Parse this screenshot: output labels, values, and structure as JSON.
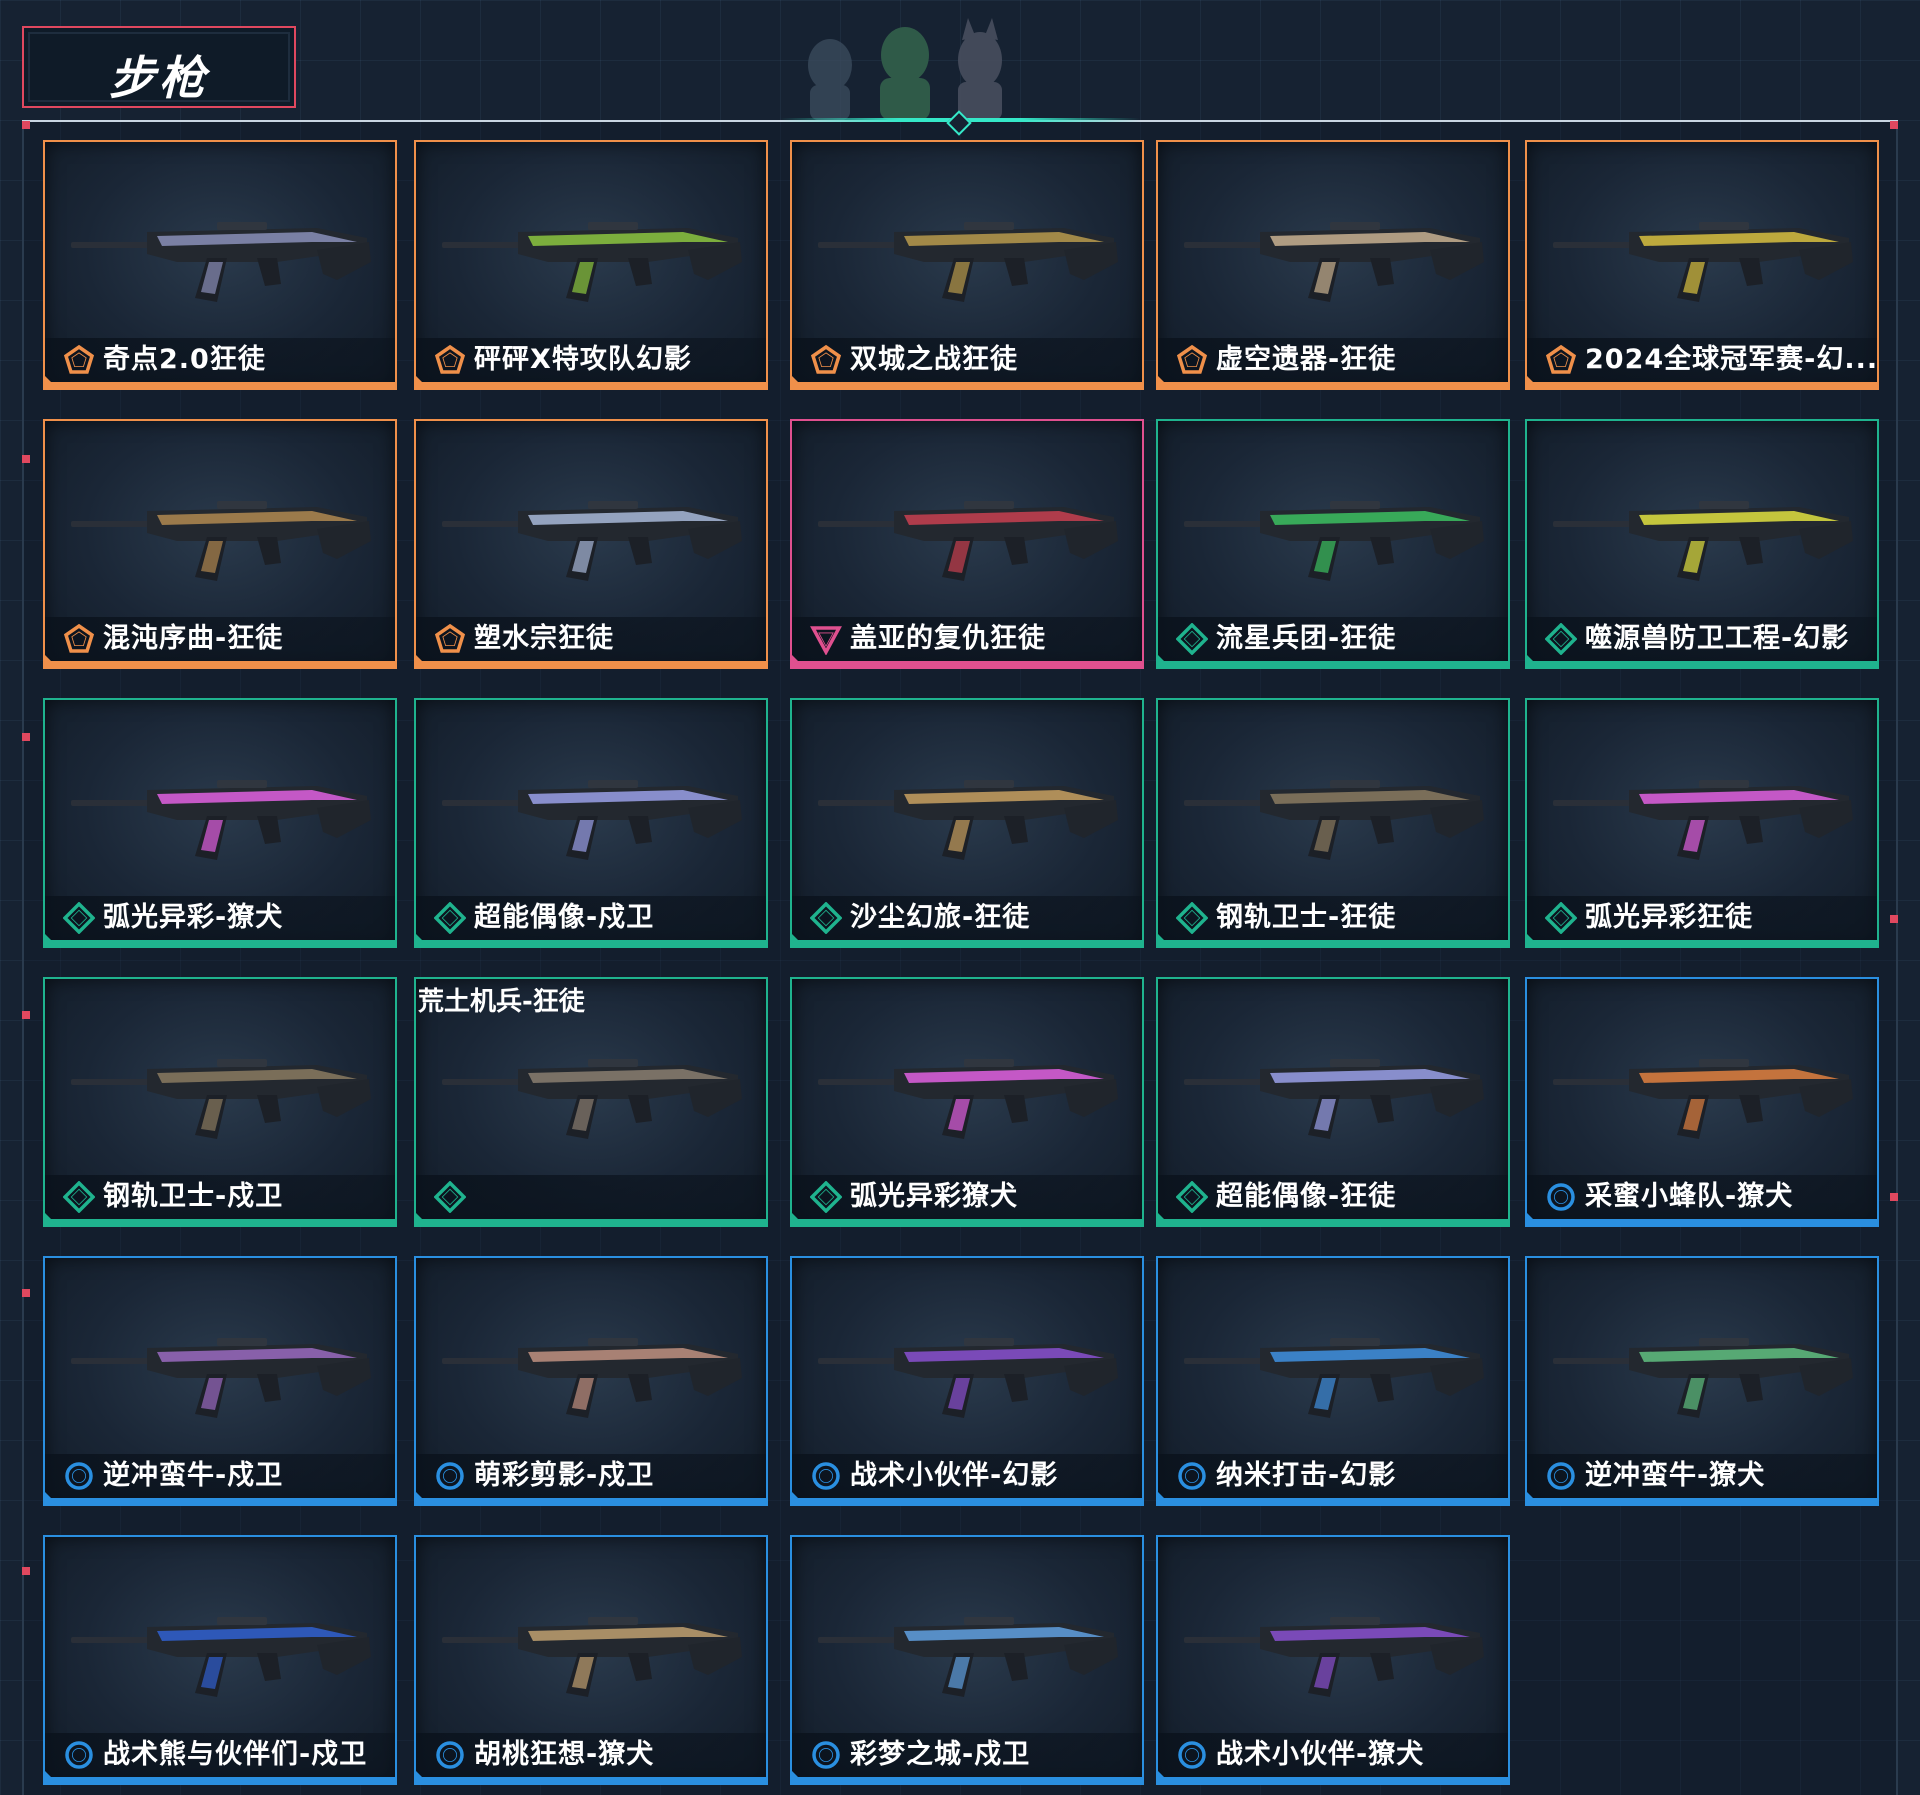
{
  "page": {
    "title": "步枪"
  },
  "tier_colors": {
    "exclusive": "#f0904a",
    "premium": "#e0508f",
    "deluxe": "#1fb38e",
    "select": "#2a8fe0"
  },
  "cards": [
    {
      "name": "奇点2.0狂徒",
      "tier": "exclusive",
      "gun_color": "#8a8fb8",
      "top_label": ""
    },
    {
      "name": "砰砰X特攻队幻影",
      "tier": "exclusive",
      "gun_color": "#8cc63f",
      "top_label": ""
    },
    {
      "name": "双城之战狂徒",
      "tier": "exclusive",
      "gun_color": "#b89a4c",
      "top_label": ""
    },
    {
      "name": "虚空遗器-狂徒",
      "tier": "exclusive",
      "gun_color": "#c8b090",
      "top_label": ""
    },
    {
      "name": "2024全球冠军赛-幻...",
      "tier": "exclusive",
      "gun_color": "#d8c040",
      "top_label": ""
    },
    {
      "name": "混沌序曲-狂徒",
      "tier": "exclusive",
      "gun_color": "#b08850",
      "top_label": ""
    },
    {
      "name": "塑水宗狂徒",
      "tier": "exclusive",
      "gun_color": "#a8b8d8",
      "top_label": ""
    },
    {
      "name": "盖亚的复仇狂徒",
      "tier": "premium",
      "gun_color": "#c84050",
      "top_label": ""
    },
    {
      "name": "流星兵团-狂徒",
      "tier": "deluxe",
      "gun_color": "#3cc060",
      "top_label": ""
    },
    {
      "name": "噬源兽防卫工程-幻影",
      "tier": "deluxe",
      "gun_color": "#e0e040",
      "top_label": ""
    },
    {
      "name": "弧光异彩-獠犬",
      "tier": "deluxe",
      "gun_color": "#e060e0",
      "top_label": ""
    },
    {
      "name": "超能偶像-戍卫",
      "tier": "deluxe",
      "gun_color": "#9aa0e8",
      "top_label": ""
    },
    {
      "name": "沙尘幻旅-狂徒",
      "tier": "deluxe",
      "gun_color": "#c8a060",
      "top_label": ""
    },
    {
      "name": "钢轨卫士-狂徒",
      "tier": "deluxe",
      "gun_color": "#8a7a60",
      "top_label": ""
    },
    {
      "name": "弧光异彩狂徒",
      "tier": "deluxe",
      "gun_color": "#e060e0",
      "top_label": ""
    },
    {
      "name": "钢轨卫士-戍卫",
      "tier": "deluxe",
      "gun_color": "#8a7a60",
      "top_label": ""
    },
    {
      "name": "",
      "tier": "deluxe",
      "gun_color": "#8a7e70",
      "top_label": "荒土机兵-狂徒"
    },
    {
      "name": "弧光异彩獠犬",
      "tier": "deluxe",
      "gun_color": "#e060e0",
      "top_label": ""
    },
    {
      "name": "超能偶像-狂徒",
      "tier": "deluxe",
      "gun_color": "#9aa0e8",
      "top_label": ""
    },
    {
      "name": "采蜜小蜂队-獠犬",
      "tier": "select",
      "gun_color": "#e08040",
      "top_label": ""
    },
    {
      "name": "逆冲蛮牛-戍卫",
      "tier": "select",
      "gun_color": "#9a6ac0",
      "top_label": ""
    },
    {
      "name": "萌彩剪影-戍卫",
      "tier": "select",
      "gun_color": "#c09080",
      "top_label": ""
    },
    {
      "name": "战术小伙伴-幻影",
      "tier": "select",
      "gun_color": "#8a50d0",
      "top_label": ""
    },
    {
      "name": "纳米打击-幻影",
      "tier": "select",
      "gun_color": "#4090e0",
      "top_label": ""
    },
    {
      "name": "逆冲蛮牛-獠犬",
      "tier": "select",
      "gun_color": "#60c080",
      "top_label": ""
    },
    {
      "name": "战术熊与伙伴们-戍卫",
      "tier": "select",
      "gun_color": "#3060d0",
      "top_label": ""
    },
    {
      "name": "胡桃狂想-獠犬",
      "tier": "select",
      "gun_color": "#c0a070",
      "top_label": ""
    },
    {
      "name": "彩梦之城-戍卫",
      "tier": "select",
      "gun_color": "#60a0e0",
      "top_label": ""
    },
    {
      "name": "战术小伙伴-獠犬",
      "tier": "select",
      "gun_color": "#8a50d0",
      "top_label": ""
    }
  ]
}
